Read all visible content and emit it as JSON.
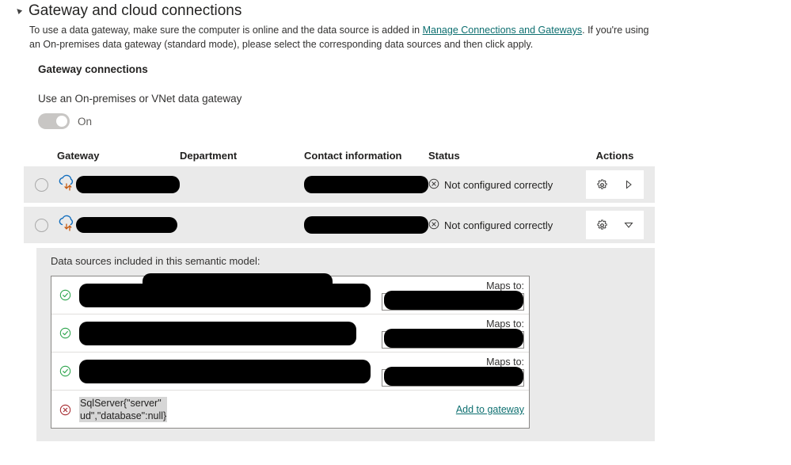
{
  "section": {
    "collapse_glyph": "◿",
    "title": "Gateway and cloud connections",
    "description_part1": "To use a data gateway, make sure the computer is online and the data source is added in ",
    "description_link": "Manage Connections and Gateways",
    "description_part2": ". If you're using an On-premises data gateway (standard mode), please select the corresponding data sources and then click apply."
  },
  "gateway_connections": {
    "sub_heading": "Gateway connections",
    "toggle_label": "Use an On-premises or VNet data gateway",
    "toggle_state": "On",
    "toggle_on": true
  },
  "table": {
    "headers": {
      "select": "",
      "gateway": "Gateway",
      "department": "Department",
      "contact": "Contact information",
      "status": "Status",
      "actions": "Actions"
    },
    "rows": [
      {
        "selected": false,
        "gateway_icon": "cloud-sync-icon",
        "gateway_name": "[redacted]",
        "department": "",
        "contact": "[redacted]",
        "status_icon": "error-circle-icon",
        "status": "Not configured correctly",
        "settings_icon": "gear-icon",
        "expand_icon": "chevron-right-icon",
        "expanded": false
      },
      {
        "selected": false,
        "gateway_icon": "cloud-sync-icon",
        "gateway_name": "[redacted]",
        "department": "",
        "contact": "[redacted]",
        "status_icon": "error-circle-icon",
        "status": "Not configured correctly",
        "settings_icon": "gear-icon",
        "expand_icon": "chevron-down-icon",
        "expanded": true
      }
    ]
  },
  "detail_panel": {
    "title": "Data sources included in this semantic model:",
    "data_sources": [
      {
        "status_icon": "check-circle-icon",
        "status": "ok",
        "name": "[redacted]",
        "maps_to_label": "Maps to:",
        "maps_to_value": "[redacted]"
      },
      {
        "status_icon": "check-circle-icon",
        "status": "ok",
        "name": "[redacted]",
        "maps_to_label": "Maps to:",
        "maps_to_value": "[redacted]"
      },
      {
        "status_icon": "check-circle-icon",
        "status": "ok",
        "name": "[redacted]",
        "maps_to_label": "Maps to:",
        "maps_to_value": "[redacted]"
      },
      {
        "status_icon": "error-circle-icon",
        "status": "error",
        "name": "SqlServer{\"server\"\nud\",\"database\":null}",
        "action_link": "Add to gateway"
      }
    ]
  },
  "colors": {
    "link": "#0d6f70",
    "row_background": "#eaeaea",
    "success": "#107c10",
    "error": "#a4262c",
    "status_icon": "#3b3a39"
  }
}
